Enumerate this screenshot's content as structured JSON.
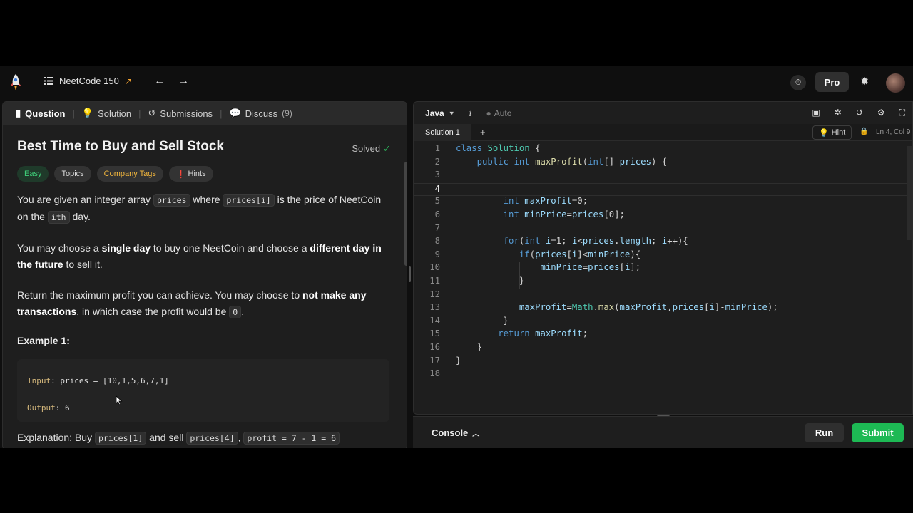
{
  "nav": {
    "list_name": "NeetCode 150",
    "pro_label": "Pro"
  },
  "left_tabs": [
    {
      "label": "Question"
    },
    {
      "label": "Solution"
    },
    {
      "label": "Submissions"
    },
    {
      "label": "Discuss",
      "count": "(9)"
    }
  ],
  "problem": {
    "title": "Best Time to Buy and Sell Stock",
    "status": "Solved",
    "tags": [
      "Easy",
      "Topics",
      "Company Tags",
      "Hints"
    ],
    "p1_a": "You are given an integer array ",
    "p1_code1": "prices",
    "p1_b": " where ",
    "p1_code2": "prices[i]",
    "p1_c": " is the price of NeetCoin on the ",
    "p1_code3": "ith",
    "p1_d": " day.",
    "p2_a": "You may choose a ",
    "p2_b1": "single day",
    "p2_c": " to buy one NeetCoin and choose a ",
    "p2_b2": "different day in the future",
    "p2_d": " to sell it.",
    "p3_a": "Return the maximum profit you can achieve. You may choose to ",
    "p3_b1": "not make any transactions",
    "p3_c": ", in which case the profit would be ",
    "p3_code": "0",
    "p3_d": ".",
    "example_title": "Example 1:",
    "ex_input_key": "Input",
    "ex_input_val": ": prices = [10,1,5,6,7,1]",
    "ex_output_key": "Output",
    "ex_output_val": ": 6",
    "explain_a": "Explanation: Buy ",
    "explain_code1": "prices[1]",
    "explain_b": " and sell ",
    "explain_code2": "prices[4]",
    "explain_c": ", ",
    "explain_code3": "profit = 7 - 1 = 6"
  },
  "editor": {
    "language": "Java",
    "info": "i",
    "auto": "Auto",
    "tab": "Solution 1",
    "hint": "Hint",
    "position": "Ln 4, Col 9"
  },
  "code_lines": [
    "1",
    "2",
    "3",
    "4",
    "5",
    "6",
    "7",
    "8",
    "9",
    "10",
    "11",
    "12",
    "13",
    "14",
    "15",
    "16",
    "17",
    "18"
  ],
  "bottom": {
    "console": "Console",
    "run": "Run",
    "submit": "Submit"
  }
}
